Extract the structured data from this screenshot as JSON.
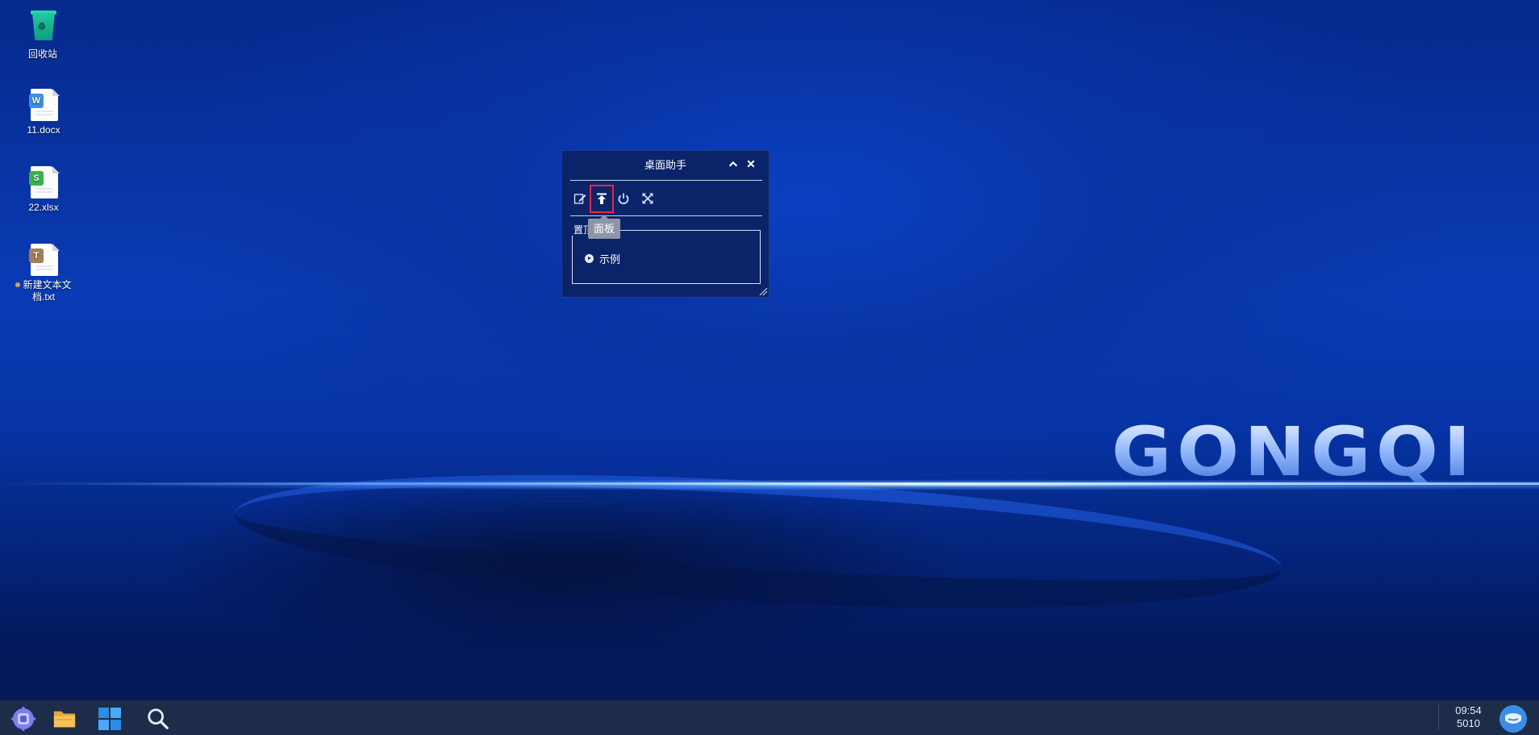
{
  "desktop": {
    "icons": [
      {
        "label": "回收站",
        "type": "recycle-bin"
      },
      {
        "label": "11.docx",
        "type": "word-doc",
        "badge": "W",
        "badge_color": "#3d8fe8"
      },
      {
        "label": "22.xlsx",
        "type": "excel-doc",
        "badge": "S",
        "badge_color": "#36b34a"
      },
      {
        "label": "新建文本文档.txt",
        "type": "text-doc",
        "badge": "T",
        "badge_color": "#a07e57"
      }
    ],
    "wallpaper_brand": "GONGQI"
  },
  "panel": {
    "title": "桌面助手",
    "tools": [
      "edit-icon",
      "pin-top-icon",
      "power-icon",
      "fullscreen-icon"
    ],
    "tooltip": "面板",
    "group_label": "置顶",
    "items": [
      {
        "label": "示例"
      }
    ]
  },
  "taskbar": {
    "clock_time": "09:54",
    "clock_sub": "5010",
    "apps": [
      "start-menu-icon",
      "file-manager-icon",
      "app-grid-icon",
      "search-icon"
    ]
  },
  "colors": {
    "accent_highlight": "#e8283a",
    "panel_bg": "#0a2369",
    "taskbar_bg": "#1c2c49"
  }
}
